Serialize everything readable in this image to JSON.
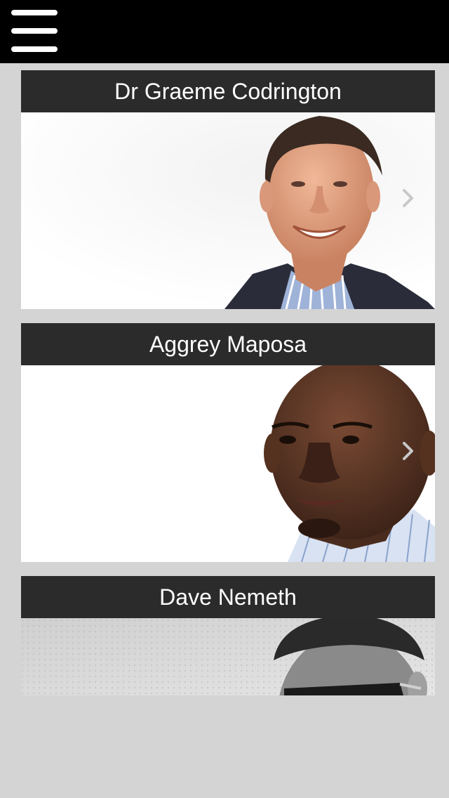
{
  "header": {
    "menu_icon": "hamburger-menu-icon",
    "background": "#000000"
  },
  "speakers": [
    {
      "name": "Dr Graeme Codrington",
      "photo": "portrait-man-smiling-suit",
      "chevron_icon": "chevron-right-icon"
    },
    {
      "name": "Aggrey Maposa",
      "photo": "portrait-man-striped-shirt",
      "chevron_icon": "chevron-right-icon"
    },
    {
      "name": "Dave Nemeth",
      "photo": "portrait-man-sunglasses-bw",
      "chevron_icon": "chevron-right-icon"
    }
  ],
  "colors": {
    "page_background": "#d4d4d4",
    "card_title_background": "#2b2b2b",
    "card_title_text": "#ffffff",
    "chevron": "#c8c8c8"
  }
}
